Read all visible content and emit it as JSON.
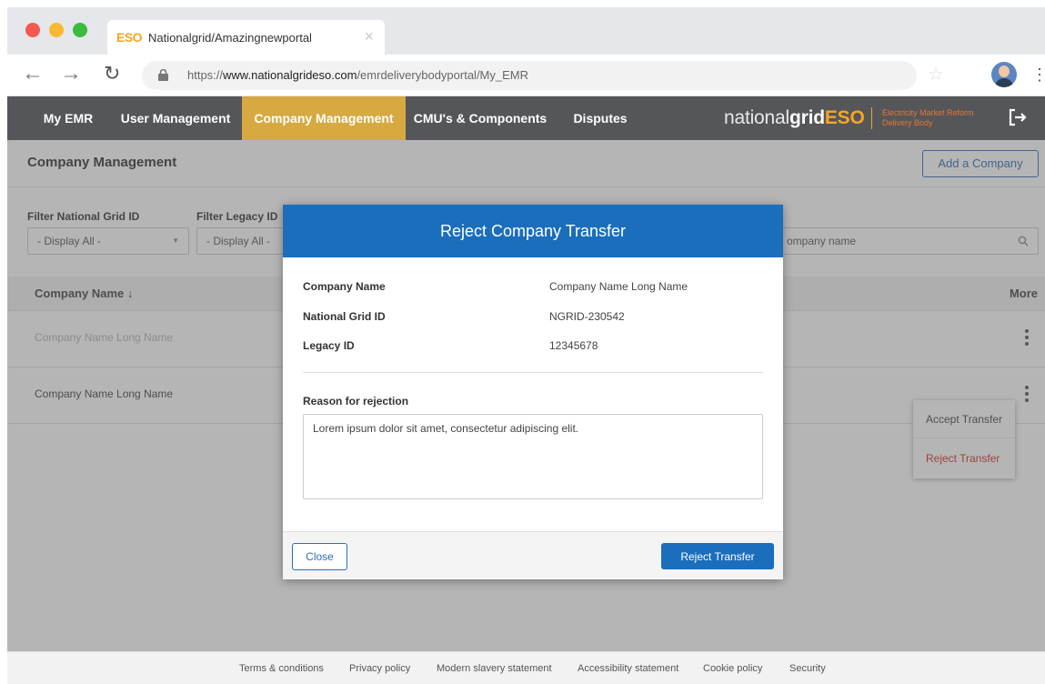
{
  "browser": {
    "tab_logo": "ESO",
    "tab_title": "Nationalgrid/Amazingnewportal",
    "url_prefix": "https://",
    "url_domain": "www.nationalgrideso.com",
    "url_path": "/emrdeliverybodyportal/My_EMR"
  },
  "nav": {
    "items": [
      {
        "label": "My EMR"
      },
      {
        "label": "User Management"
      },
      {
        "label": "Company Management"
      },
      {
        "label": "CMU's & Components"
      },
      {
        "label": "Disputes"
      }
    ],
    "active_index": 2,
    "brand_prefix": "national",
    "brand_bold": "grid",
    "brand_eso": "ESO",
    "brand_sub_line1": "Electricity Market Reform",
    "brand_sub_line2": "Delivery Body"
  },
  "page": {
    "title": "Company Management",
    "add_button": "Add a Company"
  },
  "filters": {
    "ngid_label": "Filter National Grid ID",
    "ngid_value": "- Display All -",
    "legacy_label": "Filter Legacy ID",
    "legacy_value": "- Display All -",
    "search_placeholder": "ompany name"
  },
  "table": {
    "col_name": "Company Name ↓",
    "col_more": "More",
    "rows": [
      {
        "name": "Company Name Long Name"
      },
      {
        "name": "Company Name Long Name"
      }
    ]
  },
  "row_menu": {
    "accept": "Accept Transfer",
    "reject": "Reject Transfer"
  },
  "footer": {
    "links": [
      "Terms & conditions",
      "Privacy policy",
      "Modern slavery statement",
      "Accessibility statement",
      "Cookie policy",
      "Security"
    ]
  },
  "modal": {
    "title": "Reject Company Transfer",
    "fields": [
      {
        "label": "Company Name",
        "value": "Company Name Long Name"
      },
      {
        "label": "National Grid ID",
        "value": "NGRID-230542"
      },
      {
        "label": "Legacy ID",
        "value": "12345678"
      }
    ],
    "reason_label": "Reason for rejection",
    "reason_text": "Lorem ipsum dolor sit amet, consectetur adipiscing elit.",
    "close_label": "Close",
    "reject_label": "Reject Transfer"
  },
  "colors": {
    "nav_bg": "#55565a",
    "nav_active": "#d6a941",
    "primary": "#1a6ebc",
    "reject_red": "#d0312d",
    "brand_orange": "#f6a623"
  },
  "icons": [
    "back-arrow-icon",
    "forward-arrow-icon",
    "reload-icon",
    "lock-icon",
    "star-icon",
    "kebab-icon",
    "logout-icon",
    "search-icon",
    "sort-arrow-icon"
  ]
}
